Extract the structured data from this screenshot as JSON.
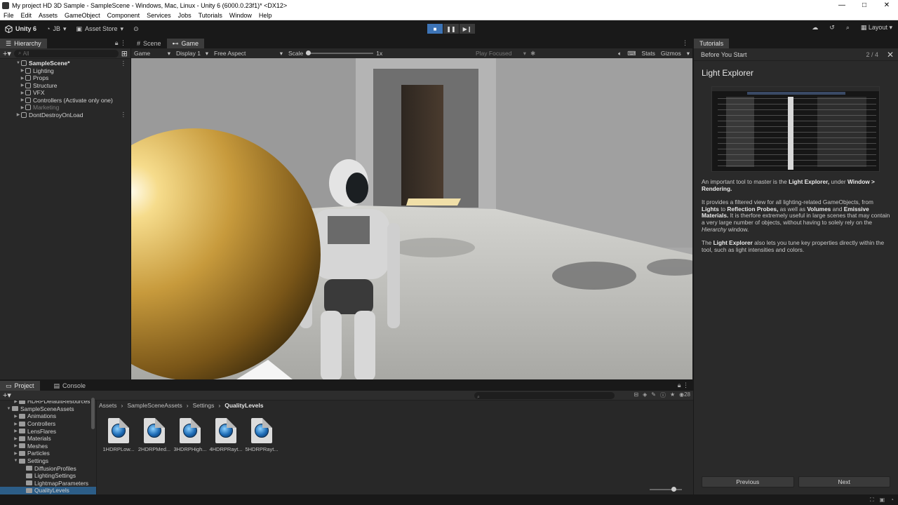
{
  "window": {
    "title": "My project HD 3D Sample - SampleScene - Windows, Mac, Linux - Unity 6 (6000.0.23f1)* <DX12>",
    "controls": [
      "—",
      "□",
      "✕"
    ]
  },
  "menu": [
    "File",
    "Edit",
    "Assets",
    "GameObject",
    "Component",
    "Services",
    "Jobs",
    "Tutorials",
    "Window",
    "Help"
  ],
  "toolbar": {
    "unity_label": "Unity 6",
    "account": "JB",
    "asset_store": "Asset Store",
    "layout": "Layout"
  },
  "hierarchy": {
    "tab": "Hierarchy",
    "search_placeholder": "All",
    "items": [
      {
        "label": "SampleScene*",
        "indent": 0,
        "expanded": true,
        "bold": true
      },
      {
        "label": "Lighting",
        "indent": 1
      },
      {
        "label": "Props",
        "indent": 1
      },
      {
        "label": "Structure",
        "indent": 1
      },
      {
        "label": "VFX",
        "indent": 1
      },
      {
        "label": "Controllers (Activate only one)",
        "indent": 1
      },
      {
        "label": "Marketing",
        "indent": 1,
        "dim": true
      },
      {
        "label": "DontDestroyOnLoad",
        "indent": 0
      }
    ]
  },
  "scene_tabs": {
    "scene": "Scene",
    "game": "Game"
  },
  "game_toolbar": {
    "mode": "Game",
    "display": "Display 1",
    "aspect": "Free Aspect",
    "scale_label": "Scale",
    "scale_value": "1x",
    "play_focused": "Play Focused",
    "stats": "Stats",
    "gizmos": "Gizmos"
  },
  "tutorials": {
    "tab": "Tutorials",
    "section": "Before You Start",
    "page": "2 / 4",
    "title": "Light Explorer",
    "previous": "Previous",
    "next": "Next"
  },
  "project": {
    "tab_project": "Project",
    "tab_console": "Console",
    "badge_count": "28",
    "breadcrumb": [
      "Assets",
      "SampleSceneAssets",
      "Settings",
      "QualityLevels"
    ],
    "folders": [
      {
        "label": "HDRPDefaultResources",
        "indent": 1
      },
      {
        "label": "SampleSceneAssets",
        "indent": 0,
        "expanded": true
      },
      {
        "label": "Animations",
        "indent": 1
      },
      {
        "label": "Controllers",
        "indent": 1
      },
      {
        "label": "LensFlares",
        "indent": 1
      },
      {
        "label": "Materials",
        "indent": 1
      },
      {
        "label": "Meshes",
        "indent": 1
      },
      {
        "label": "Particles",
        "indent": 1
      },
      {
        "label": "Settings",
        "indent": 1,
        "expanded": true
      },
      {
        "label": "DiffusionProfiles",
        "indent": 2
      },
      {
        "label": "LightingSettings",
        "indent": 2
      },
      {
        "label": "LightmapParameters",
        "indent": 2
      },
      {
        "label": "QualityLevels",
        "indent": 2,
        "selected": true
      }
    ],
    "assets": [
      "1HDRPLow...",
      "2HDRPMed...",
      "3HDRPHigh...",
      "4HDRPRayt...",
      "5HDRPRayt..."
    ]
  }
}
